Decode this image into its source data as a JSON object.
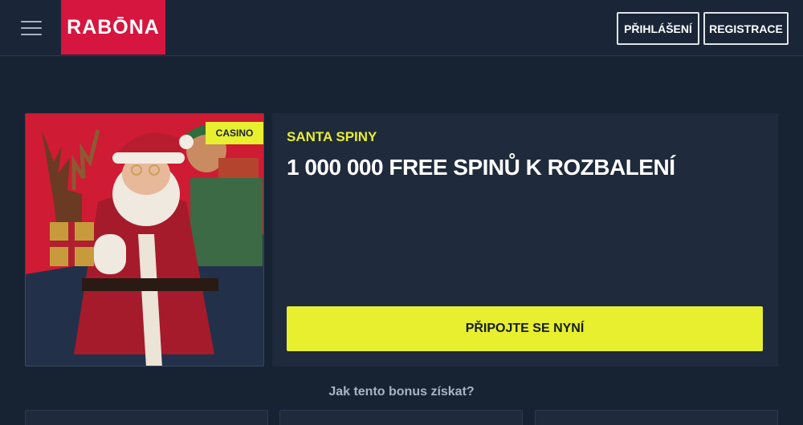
{
  "header": {
    "menu_icon": "hamburger-menu-icon",
    "logo_text": "RABŌNA",
    "login_label": "PŘIHLÁŠENÍ",
    "register_label": "REGISTRACE"
  },
  "promo": {
    "badge": "CASINO",
    "subtitle": "SANTA SPINY",
    "title": "1 000 000 FREE SPINŮ K ROZBALENÍ",
    "cta_label": "PŘIPOJTE SE NYNÍ"
  },
  "how_to": {
    "heading": "Jak tento bonus získat?"
  },
  "colors": {
    "brand_red": "#d6163f",
    "accent_yellow": "#e7ef2f",
    "background": "#172233",
    "panel": "#1f2a3c"
  }
}
